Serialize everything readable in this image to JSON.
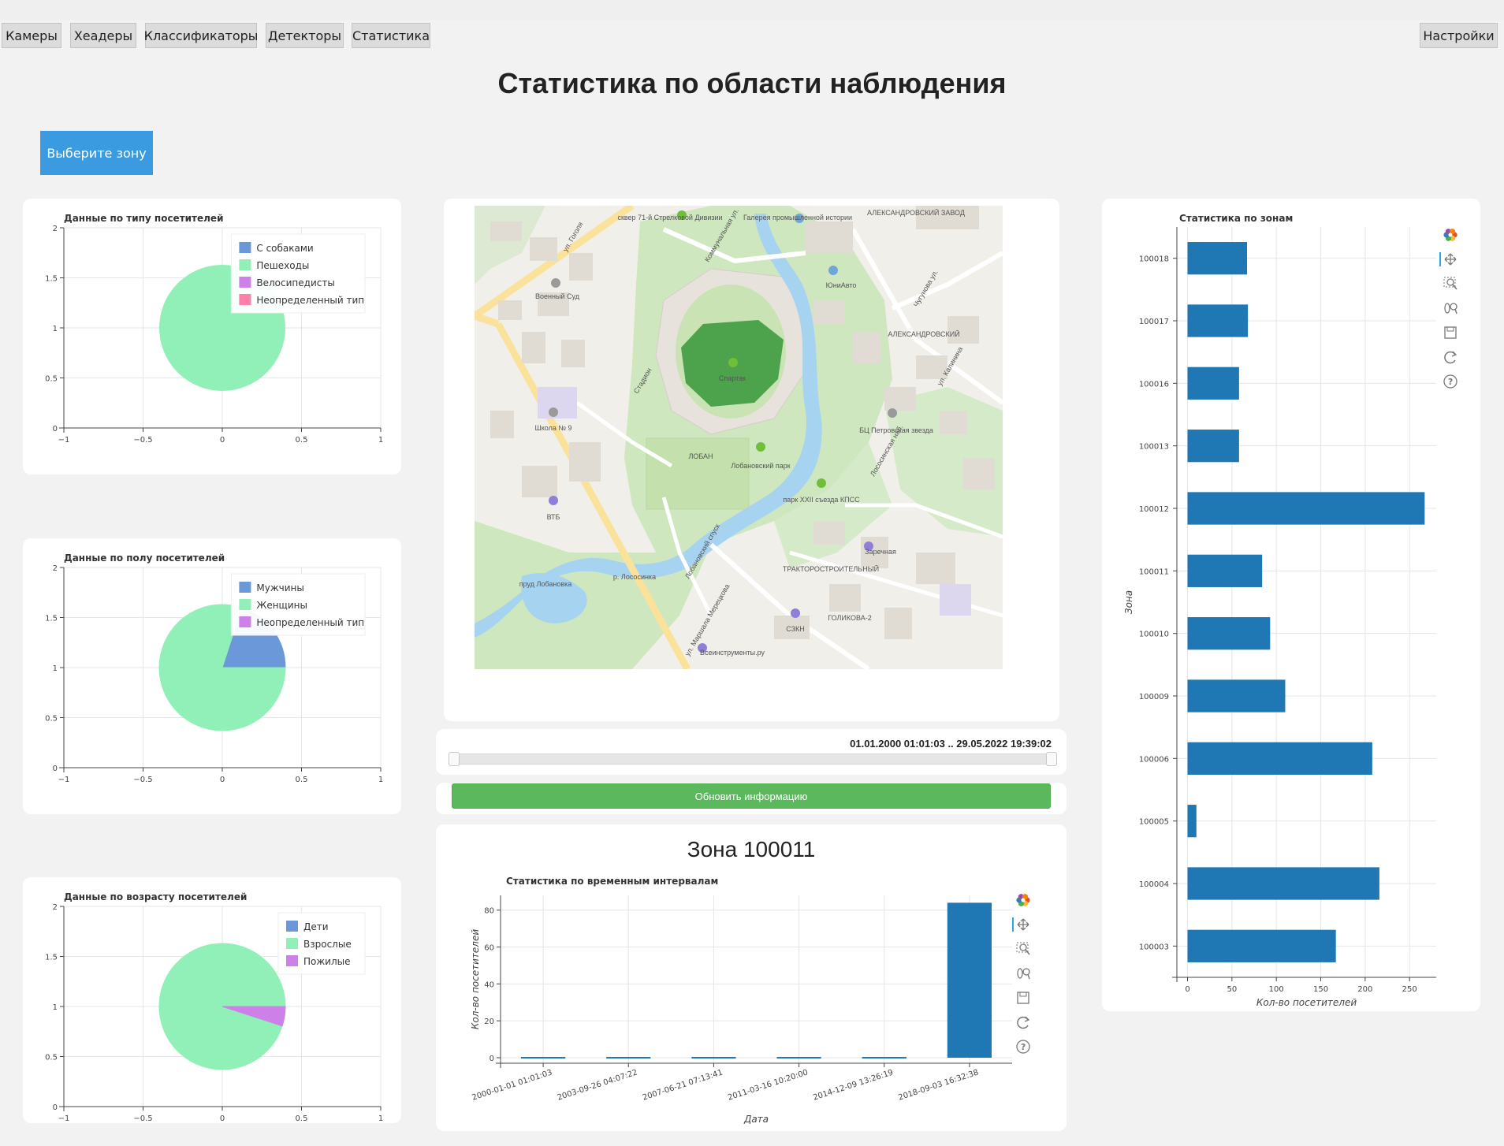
{
  "nav": {
    "items": [
      {
        "label": "Камеры",
        "name": "nav-cameras"
      },
      {
        "label": "Хеадеры",
        "name": "nav-headers"
      },
      {
        "label": "Классификаторы",
        "name": "nav-classifiers"
      },
      {
        "label": "Детекторы",
        "name": "nav-detectors"
      },
      {
        "label": "Статистика",
        "name": "nav-statistics"
      }
    ],
    "settings_label": "Настройки"
  },
  "page": {
    "title": "Статистика по области наблюдения"
  },
  "zone_select": {
    "label": "Выберите зону"
  },
  "slider": {
    "range_label": "01.01.2000 01:01:03 .. 29.05.2022 19:39:02",
    "start": 0,
    "end": 1
  },
  "update_button": {
    "label": "Обновить информацию"
  },
  "zone_panel": {
    "title": "Зона 100011"
  },
  "colors": {
    "pie_blue": "#6a98d8",
    "pie_green": "#90f0b8",
    "pie_purple": "#cc80e8",
    "pie_pink": "#ff7faa",
    "bar": "#1f77b4",
    "update_button": "#5cb85c",
    "zone_button": "#3a9be0"
  },
  "toolbar_icons": [
    "bokeh-logo-icon",
    "pan-icon",
    "box-zoom-icon",
    "wheel-zoom-icon",
    "save-icon",
    "reset-icon",
    "help-icon"
  ],
  "map": {
    "labels": [
      "сквер 71-й Стрелковой Дивизии",
      "Галерея промышленной истории",
      "АЛЕКСАНДРОВСКИЙ ЗАВОД",
      "ул. Гоголя",
      "Коммунальная ул.",
      "ЮниАвто",
      "Военный Суд",
      "Спартак",
      "АЛЕКСАНДРОВСКИЙ",
      "Чугунова ул.",
      "ул. Калинина",
      "Стадион",
      "Школа № 9",
      "БЦ Петровская звезда",
      "ЛОБАН",
      "Лобановский парк",
      "ВТБ",
      "парк XXII съезда КПСС",
      "Лососинская наб.",
      "Заречная",
      "пруд Лобановка",
      "р. Лососинка",
      "ТРАКТОРОСТРОИТЕЛЬНЫЙ",
      "СЗКН",
      "ГОЛИКОВА-2",
      "ул. Маршала Мерецкова",
      "Всеинструменты.ру",
      "Лобановский спуск"
    ]
  },
  "chart_data": [
    {
      "type": "pie",
      "title": "Данные по типу посетителей",
      "categories": [
        "С собаками",
        "Пешеходы",
        "Велосипедисты",
        "Неопределенный тип"
      ],
      "values": [
        0,
        100,
        0,
        0
      ],
      "colors": [
        "#6a98d8",
        "#90f0b8",
        "#cc80e8",
        "#ff7faa"
      ],
      "xlim": [
        -1,
        1
      ],
      "ylim": [
        0,
        2
      ],
      "xticks": [
        "−1",
        "−0.5",
        "0",
        "0.5",
        "1"
      ],
      "yticks": [
        "0",
        "0.5",
        "1",
        "1.5",
        "2"
      ],
      "legend": "top-right",
      "grid": true
    },
    {
      "type": "pie",
      "title": "Данные по полу посетителей",
      "categories": [
        "Мужчины",
        "Женщины",
        "Неопределенный тип"
      ],
      "values": [
        20,
        80,
        0
      ],
      "colors": [
        "#6a98d8",
        "#90f0b8",
        "#cc80e8"
      ],
      "xlim": [
        -1,
        1
      ],
      "ylim": [
        0,
        2
      ],
      "xticks": [
        "−1",
        "−0.5",
        "0",
        "0.5",
        "1"
      ],
      "yticks": [
        "0",
        "0.5",
        "1",
        "1.5",
        "2"
      ],
      "legend": "top-right",
      "grid": true
    },
    {
      "type": "pie",
      "title": "Данные по возрасту посетителей",
      "categories": [
        "Дети",
        "Взрослые",
        "Пожилые"
      ],
      "values": [
        0,
        95,
        5
      ],
      "colors": [
        "#6a98d8",
        "#90f0b8",
        "#cc80e8"
      ],
      "xlim": [
        -1,
        1
      ],
      "ylim": [
        0,
        2
      ],
      "xticks": [
        "−1",
        "−0.5",
        "0",
        "0.5",
        "1"
      ],
      "yticks": [
        "0",
        "0.5",
        "1",
        "1.5",
        "2"
      ],
      "legend": "top-right",
      "grid": true
    },
    {
      "type": "bar",
      "orientation": "horizontal",
      "title": "Статистика по зонам",
      "categories": [
        "100018",
        "100017",
        "100016",
        "100013",
        "100012",
        "100011",
        "100010",
        "100009",
        "100006",
        "100005",
        "100004",
        "100003"
      ],
      "values": [
        67,
        68,
        58,
        58,
        267,
        84,
        93,
        110,
        208,
        10,
        216,
        167
      ],
      "xlabel": "Кол-во посетителей",
      "ylabel": "Зона",
      "xlim": [
        -12,
        280
      ],
      "xticks": [
        0,
        50,
        100,
        150,
        200,
        250
      ],
      "grid": true
    },
    {
      "type": "bar",
      "title": "Статистика по временным интервалам",
      "categories": [
        "2000-01-01 01:01:03",
        "2003-09-26 04:07:22",
        "2007-06-21 07:13:41",
        "2011-03-16 10:20:00",
        "2014-12-09 13:26:19",
        "2018-09-03 16:32:38"
      ],
      "values": [
        0,
        0,
        0,
        0,
        0,
        84
      ],
      "xlabel": "Дата",
      "ylabel": "Кол-во посетителей",
      "ylim": [
        -3,
        88
      ],
      "yticks": [
        0,
        20,
        40,
        60,
        80
      ],
      "grid": true
    }
  ]
}
